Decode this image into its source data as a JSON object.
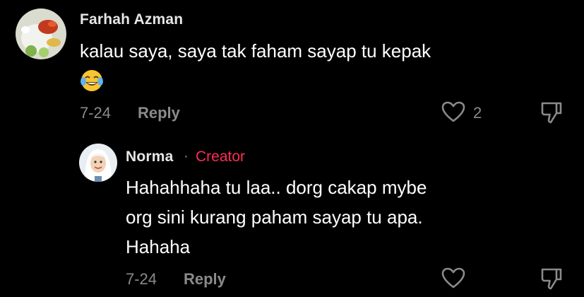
{
  "comments": [
    {
      "username": "Farhah Azman",
      "text_line1": "kalau saya, saya tak faham sayap tu kepak",
      "emoji": "face-with-tears-of-joy",
      "date": "7-24",
      "reply_label": "Reply",
      "like_count": "2"
    }
  ],
  "reply": {
    "username": "Norma",
    "separator": "·",
    "badge": "Creator",
    "text_lines": [
      "Hahahhaha tu laa.. dorg cakap mybe",
      "org sini kurang paham sayap tu apa.",
      "Hahaha"
    ],
    "date": "7-24",
    "reply_label": "Reply"
  },
  "colors": {
    "background": "#000000",
    "text": "#ffffff",
    "muted": "#8a8a8a",
    "creator": "#fe2c55"
  },
  "icons": [
    "heart-outline-icon",
    "thumbs-down-icon"
  ]
}
